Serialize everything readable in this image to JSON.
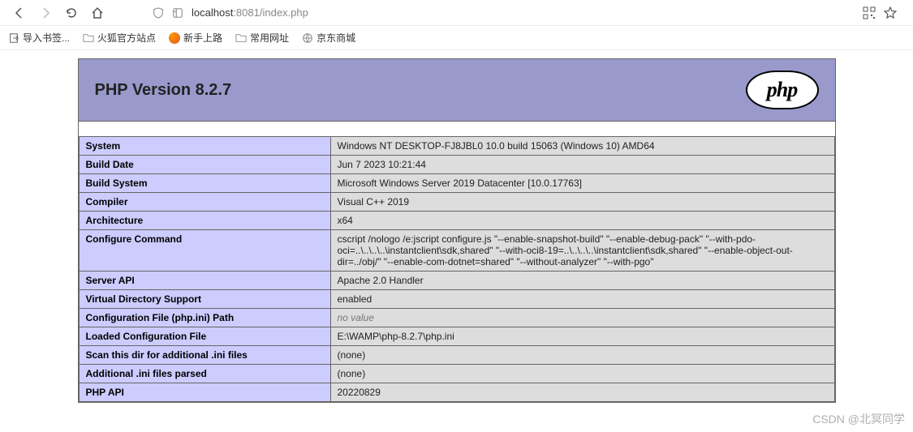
{
  "url": {
    "host": "localhost",
    "port": ":8081",
    "path": "/index.php"
  },
  "bookmarks": {
    "import": "导入书签...",
    "items": [
      {
        "label": "火狐官方站点",
        "type": "folder"
      },
      {
        "label": "新手上路",
        "type": "ff"
      },
      {
        "label": "常用网址",
        "type": "folder"
      },
      {
        "label": "京东商城",
        "type": "jd"
      }
    ]
  },
  "header": {
    "title": "PHP Version 8.2.7",
    "logo_text": "php"
  },
  "rows": [
    {
      "k": "System",
      "v": "Windows NT DESKTOP-FJ8JBL0 10.0 build 15063 (Windows 10) AMD64"
    },
    {
      "k": "Build Date",
      "v": "Jun 7 2023 10:21:44"
    },
    {
      "k": "Build System",
      "v": "Microsoft Windows Server 2019 Datacenter [10.0.17763]"
    },
    {
      "k": "Compiler",
      "v": "Visual C++ 2019"
    },
    {
      "k": "Architecture",
      "v": "x64"
    },
    {
      "k": "Configure Command",
      "v": "cscript /nologo /e:jscript configure.js \"--enable-snapshot-build\" \"--enable-debug-pack\" \"--with-pdo-oci=..\\..\\..\\..\\instantclient\\sdk,shared\" \"--with-oci8-19=..\\..\\..\\..\\instantclient\\sdk,shared\" \"--enable-object-out-dir=../obj/\" \"--enable-com-dotnet=shared\" \"--without-analyzer\" \"--with-pgo\""
    },
    {
      "k": "Server API",
      "v": "Apache 2.0 Handler"
    },
    {
      "k": "Virtual Directory Support",
      "v": "enabled"
    },
    {
      "k": "Configuration File (php.ini) Path",
      "v": "no value",
      "italic": true
    },
    {
      "k": "Loaded Configuration File",
      "v": "E:\\WAMP\\php-8.2.7\\php.ini"
    },
    {
      "k": "Scan this dir for additional .ini files",
      "v": "(none)"
    },
    {
      "k": "Additional .ini files parsed",
      "v": "(none)"
    },
    {
      "k": "PHP API",
      "v": "20220829"
    }
  ],
  "watermark": "CSDN @北冥同学"
}
